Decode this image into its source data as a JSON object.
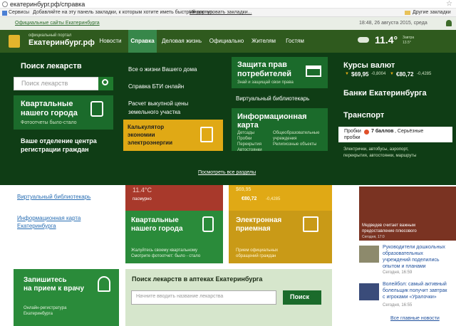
{
  "browser": {
    "url": "екатеринбург.рф/справка",
    "bookmarks": {
      "services": "Сервисы",
      "hint": "Добавляйте на эту панель закладки, к которым хотите иметь быстрый доступ.",
      "import": "Импортировать закладки...",
      "other": "Другие закладки"
    }
  },
  "portal": {
    "official_sites": "Официальные сайты Екатеринбурга",
    "datetime": "18:48, 26 августа 2015, среда",
    "logo_small": "официальный портал",
    "logo_big": "Екатеринбург.рф"
  },
  "nav": [
    "Новости",
    "Справка",
    "Деловая жизнь",
    "Официально",
    "Жителям",
    "Гостям"
  ],
  "weather": {
    "temp": "11.4°",
    "tomorrow_label": "Завтра",
    "tomorrow_temp": "13.5°"
  },
  "mega": {
    "search_title": "Поиск лекарств",
    "search_placeholder": "Поиск лекарств",
    "kv_title_1": "Квартальные",
    "kv_title_2": "нашего города",
    "kv_sub": "Фотоотчеты было-стало",
    "office_1": "Ваше отделение центра",
    "office_2": "регистрации граждан",
    "links": [
      "Все о жизни Вашего дома",
      "Справка БТИ онлайн",
      "Расчет выкупной цены",
      "земельного участка"
    ],
    "calc_1": "Калькулятор",
    "calc_2": "экономии",
    "calc_3": "электроэнергии",
    "pravo_1": "Защита прав",
    "pravo_2": "потребителей",
    "pravo_sub": "Знай и защищай свои права",
    "library": "Виртуальный библиотекарь",
    "infomap_1": "Информационная",
    "infomap_2": "карта",
    "infomap_cols": [
      [
        "Детсады",
        "Пробки",
        "Перекрытия",
        "Автостоянки"
      ],
      [
        "Общеобразовательные",
        "учреждения",
        "Религиозные объекты"
      ]
    ],
    "rates_title": "Курсы валют",
    "usd": "$69,95",
    "usd_delta": "-0,8004",
    "eur": "€80,72",
    "eur_delta": "-0,4285",
    "banks": "Банки Екатеринбурга",
    "transport": "Транспорт",
    "probki_label": "Пробки",
    "probki_score": "7 баллов",
    "probki_text_1": ", Серьёзные",
    "probki_text_2": "пробки",
    "transport_links_1": "Электрички, автобусы, аэропорт,",
    "transport_links_2": "перекрытия, автостоянки, маршруты",
    "all_sections": "Посмотреть все разделы"
  },
  "page": {
    "left_links": [
      "Виртуальный библиотекарь",
      "Информационная карта",
      "Екатеринбурга"
    ],
    "under_weather": "11.4°С",
    "under_weather_sub": "пасмурно",
    "under_usd": "$69,95",
    "under_eur": "€80,72",
    "under_eur_delta": "-0,4285",
    "card_kv_1": "Квартальные",
    "card_kv_2": "нашего города",
    "card_kv_sub_1": "Жалуйтесь своему квартальному",
    "card_kv_sub_2": "Смотрите фотоотчет: было - стало",
    "card_el_1": "Электронная",
    "card_el_2": "приемная",
    "card_el_sub_1": "Прием официальных",
    "card_el_sub_2": "обращений граждан",
    "card_zap_1": "Запишитесь",
    "card_zap_2": "на прием к врачу",
    "card_zap_sub_1": "Онлайн-регистратура",
    "card_zap_sub_2": "Екатеринбурга",
    "lek_title": "Поиск лекарств в аптеках Екатеринбурга",
    "lek_placeholder": "Начните вводить название лекарства",
    "lek_button": "Поиск",
    "news_photo_1": "Медведев считает важным",
    "news_photo_2": "предоставление плюсового",
    "news_photo_date": "Сегодня, 17:0",
    "news": [
      {
        "l1": "Руководители дошкольных",
        "l2": "образовательных",
        "l3": "учреждений поделились",
        "l4": "опытом и планами",
        "date": "Сегодня, 16:59"
      },
      {
        "l1": "Волейбол: самый активный",
        "l2": "болельщик получит завтрак",
        "l3": "с игроками «Уралочки»",
        "l4": "",
        "date": "Сегодня, 16:55"
      }
    ],
    "all_news": "Все главные новости"
  }
}
